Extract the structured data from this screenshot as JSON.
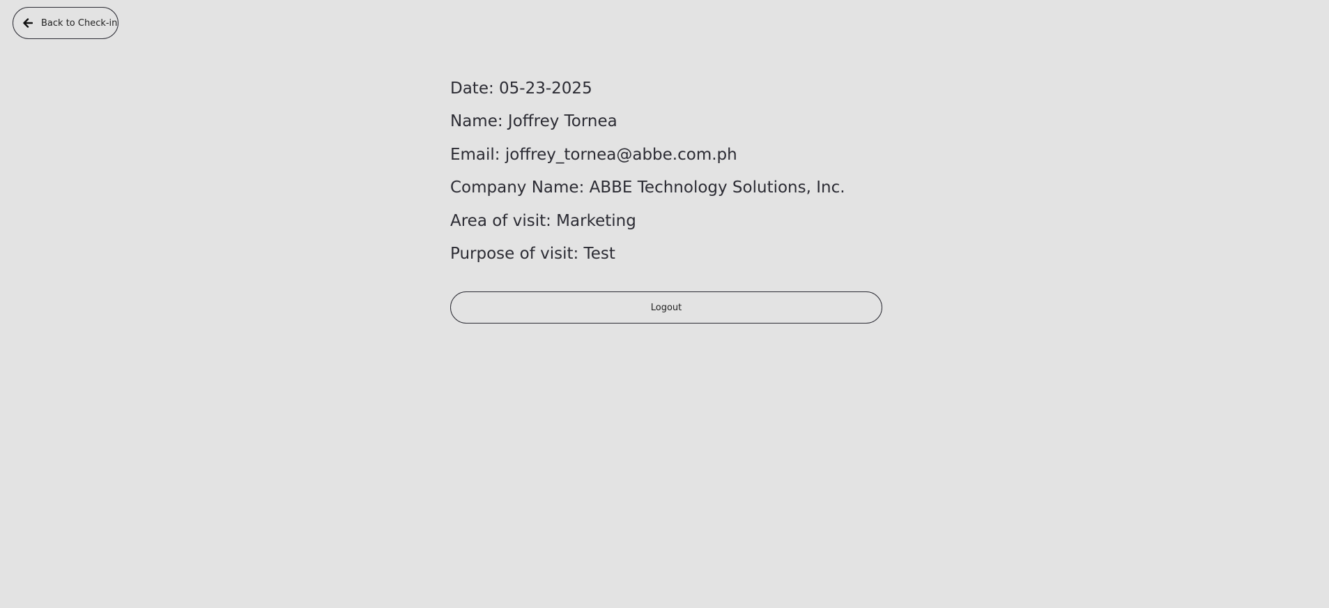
{
  "header": {
    "back_label": "Back to Check-in",
    "back_icon": "arrow-left-icon"
  },
  "visit": {
    "date": "Date: 05-23-2025",
    "name": "Name: Joffrey Tornea",
    "email": "Email: joffrey_tornea@abbe.com.ph",
    "company": "Company Name: ABBE Technology Solutions, Inc.",
    "area": "Area of visit: Marketing",
    "purpose": "Purpose of visit: Test"
  },
  "actions": {
    "logout_label": "Logout"
  }
}
